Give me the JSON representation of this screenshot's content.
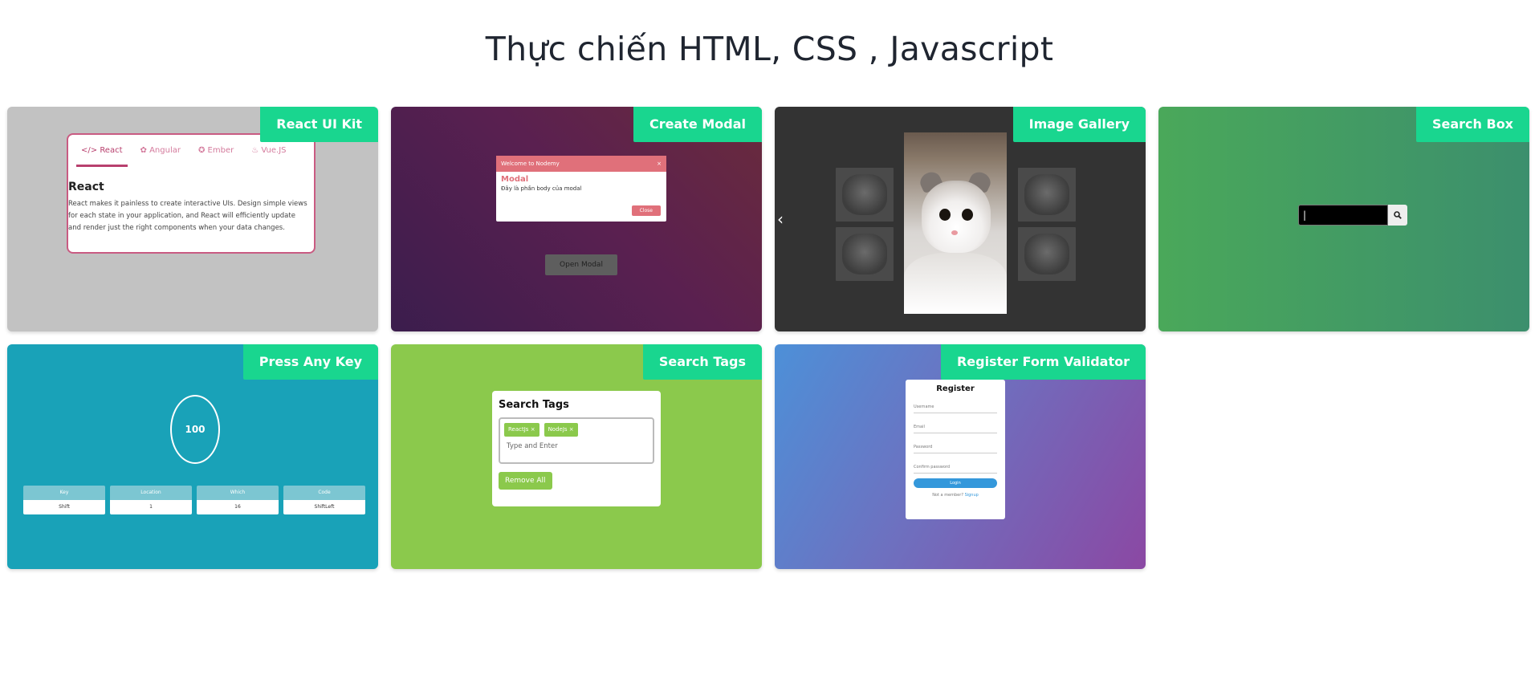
{
  "page": {
    "title": "Thực chiến HTML, CSS , Javascript"
  },
  "cards": [
    {
      "label": "React UI Kit",
      "preview": {
        "tabs": [
          "React",
          "Angular",
          "Ember",
          "Vue.JS"
        ],
        "heading": "React",
        "body": "React makes it painless to create interactive UIs. Design simple views for each state in your application, and React will efficiently update and render just the right components when your data changes."
      }
    },
    {
      "label": "Create Modal",
      "preview": {
        "modal_header": "Welcome to Nodemy",
        "close_glyph": "×",
        "modal_title": "Modal",
        "modal_body": "Đây là phần body của modal",
        "close_button": "Close",
        "open_button": "Open Modal"
      }
    },
    {
      "label": "Image Gallery",
      "preview": {
        "prev_glyph": "‹"
      }
    },
    {
      "label": "Search Box",
      "preview": {
        "cursor": "|",
        "search_glyph": "🔍"
      }
    },
    {
      "label": "Press Any Key",
      "preview": {
        "value": "100",
        "boxes": [
          {
            "header": "Key",
            "value": "Shift"
          },
          {
            "header": "Location",
            "value": "1"
          },
          {
            "header": "Which",
            "value": "16"
          },
          {
            "header": "Code",
            "value": "ShiftLeft"
          }
        ]
      }
    },
    {
      "label": "Search Tags",
      "preview": {
        "title": "Search Tags",
        "tags": [
          "ReactJs",
          "NodeJs"
        ],
        "tag_remove_glyph": "×",
        "placeholder": "Type and Enter",
        "remove_all": "Remove All"
      }
    },
    {
      "label": "Register Form Validator",
      "preview": {
        "title": "Register",
        "fields": [
          "Username",
          "Email",
          "Password",
          "Confirm password"
        ],
        "button": "Login",
        "footer_text": "Not a member?",
        "footer_link": "Signup"
      }
    }
  ],
  "colors": {
    "label_bg": "#19d68f",
    "react_card_bg": "#c2c2c2",
    "gallery_bg": "#333333",
    "press_key_bg": "#19a2b8",
    "search_tags_bg": "#8bc94c",
    "react_accent": "#b8406e",
    "modal_accent": "#e0707a"
  }
}
